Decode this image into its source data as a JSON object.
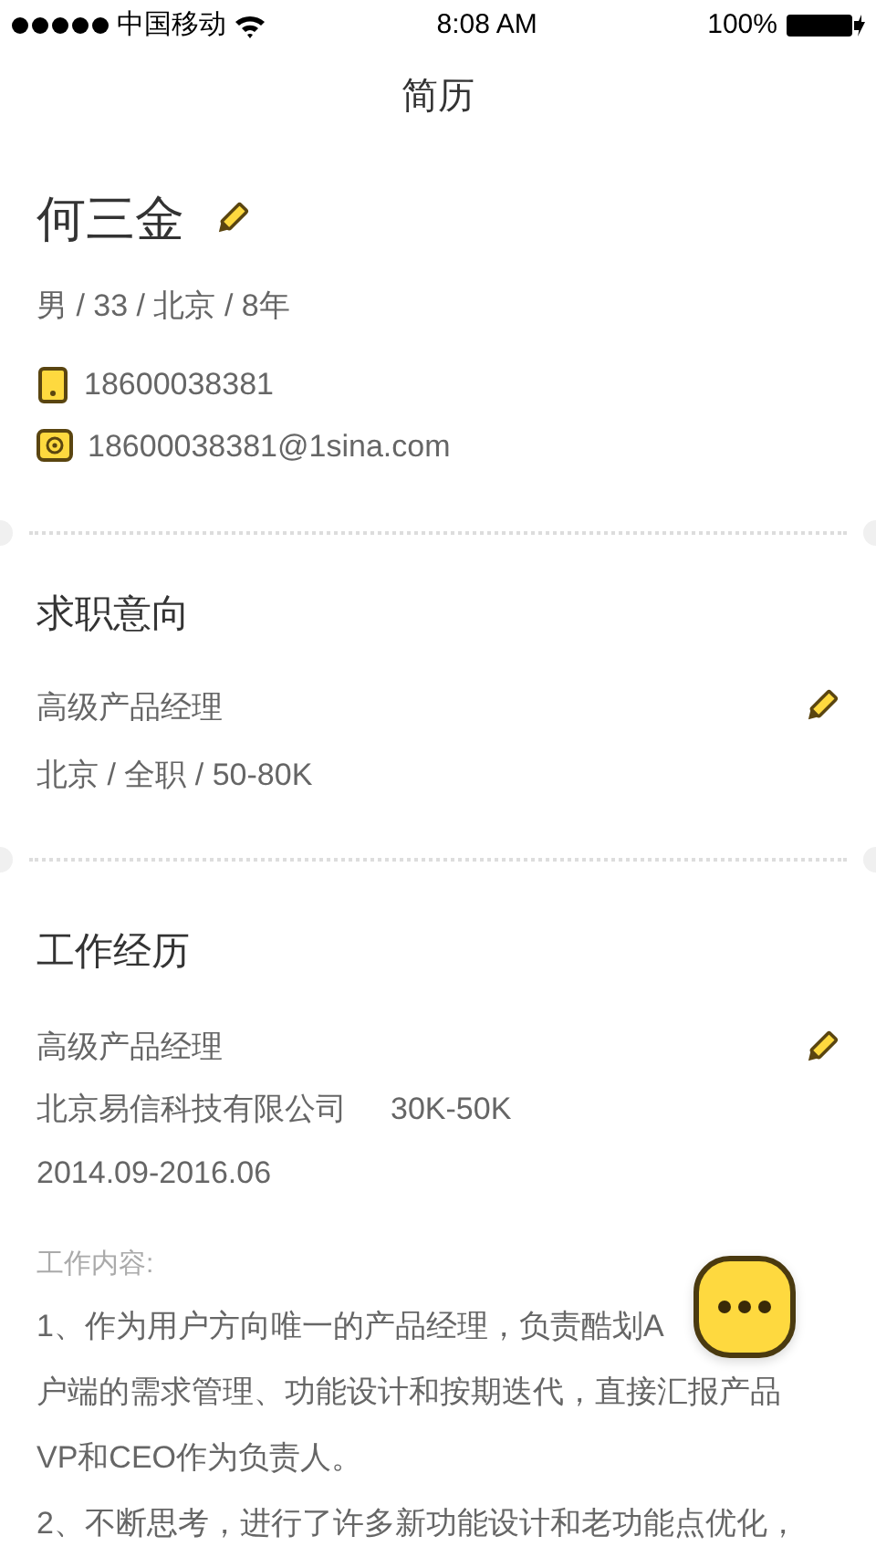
{
  "status_bar": {
    "carrier": "中国移动",
    "time": "8:08 AM",
    "battery": "100%"
  },
  "nav": {
    "title": "简历"
  },
  "profile": {
    "name": "何三金",
    "info": "男 / 33 / 北京 / 8年",
    "contacts": [
      {
        "kind": "phone",
        "text": "18600038381"
      },
      {
        "kind": "email",
        "text": "18600038381@1sina.com"
      }
    ]
  },
  "intention": {
    "title": "求职意向",
    "position": "高级产品经理",
    "details": "北京 / 全职 / 50-80K"
  },
  "experience": {
    "title": "工作经历",
    "position": "高级产品经理",
    "company": "北京易信科技有限公司",
    "salary": "30K-50K",
    "period": "2014.09-2016.06",
    "content_label": "工作内容:",
    "content_lines": [
      "1、作为用户方向唯一的产品经理，负责酷划A",
      "户端的需求管理、功能设计和按期迭代，直接汇报产品",
      "VP和CEO作为负责人。",
      "2、不断思考，进行了许多新功能设计和老功能点优化，"
    ]
  }
}
